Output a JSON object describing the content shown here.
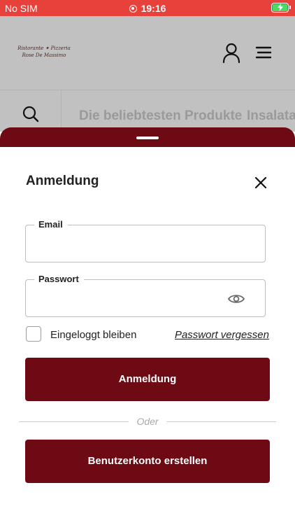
{
  "status_bar": {
    "carrier": "No SIM",
    "time": "19:16",
    "battery_icon": "battery-charging-icon",
    "battery_color": "#4cd964",
    "color": "#e8413b"
  },
  "header": {
    "logo_line1": "Ristorante ✦ Pizzeria",
    "logo_line2": "Rose De Massimo",
    "user_icon": "user-icon",
    "menu_icon": "hamburger-menu-icon"
  },
  "nav": {
    "search_icon": "search-icon",
    "categories": [
      "Die beliebtesten Produkte",
      "Insalata"
    ]
  },
  "login": {
    "title": "Anmeldung",
    "close_icon": "close-icon",
    "email": {
      "label": "Email",
      "value": "",
      "placeholder": ""
    },
    "password": {
      "label": "Passwort",
      "value": "",
      "placeholder": "",
      "toggle_icon": "eye-icon"
    },
    "remember_label": "Eingeloggt bleiben",
    "remember_checked": false,
    "forgot_label": "Passwort vergessen",
    "submit_label": "Anmeldung",
    "divider_label": "Oder",
    "register_label": "Benutzerkonto erstellen"
  },
  "colors": {
    "brand": "#6e0a13",
    "header_bg": "#c1c1c1"
  }
}
